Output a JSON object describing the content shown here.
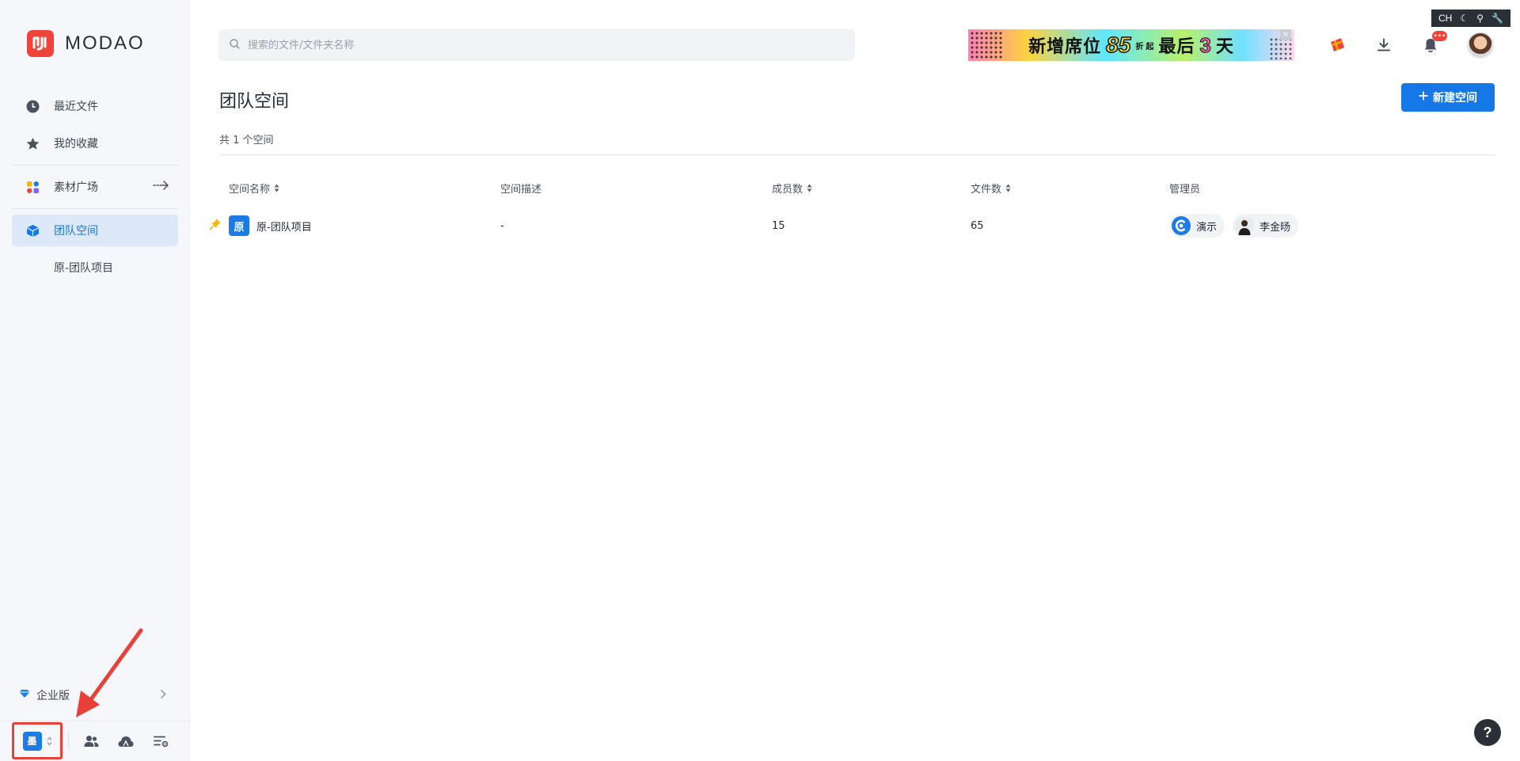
{
  "brand": {
    "logo_glyph": "4",
    "name": "MODAO",
    "color": "#f0443b"
  },
  "sidebar": {
    "items": [
      {
        "label": "最近文件",
        "icon": "clock-icon"
      },
      {
        "label": "我的收藏",
        "icon": "star-icon"
      },
      {
        "label": "素材广场",
        "icon": "apps-icon",
        "trailing": "arrow-right-icon"
      },
      {
        "label": "团队空间",
        "icon": "cube-icon",
        "active": true
      }
    ],
    "sub_items": [
      "原-团队项目"
    ],
    "enterprise_label": "企业版",
    "team_badge": "墨"
  },
  "search": {
    "placeholder": "搜索的文件/文件夹名称"
  },
  "banner": {
    "text1": "新增席位",
    "number": "85",
    "small1": "折",
    "small2": "起",
    "text2": "最后",
    "number2": "3",
    "text3": "天",
    "close": "×"
  },
  "topbar": {
    "notif_badge": "•••",
    "dev_toolbar": [
      "CH",
      "☾",
      "⚲",
      "🔧"
    ]
  },
  "main": {
    "title": "团队空间",
    "new_button": "新建空间",
    "count_text": "共 1 个空间",
    "columns": [
      "空间名称",
      "空间描述",
      "成员数",
      "文件数",
      "管理员"
    ],
    "rows": [
      {
        "badge": "原",
        "name": "原-团队项目",
        "description": "-",
        "members": "15",
        "files": "65",
        "admins": [
          "演示",
          "李金旸"
        ]
      }
    ]
  },
  "help": "?",
  "colors": {
    "accent": "#1677e6",
    "active_bg": "#dde9f9",
    "annotation": "#e8413a"
  }
}
